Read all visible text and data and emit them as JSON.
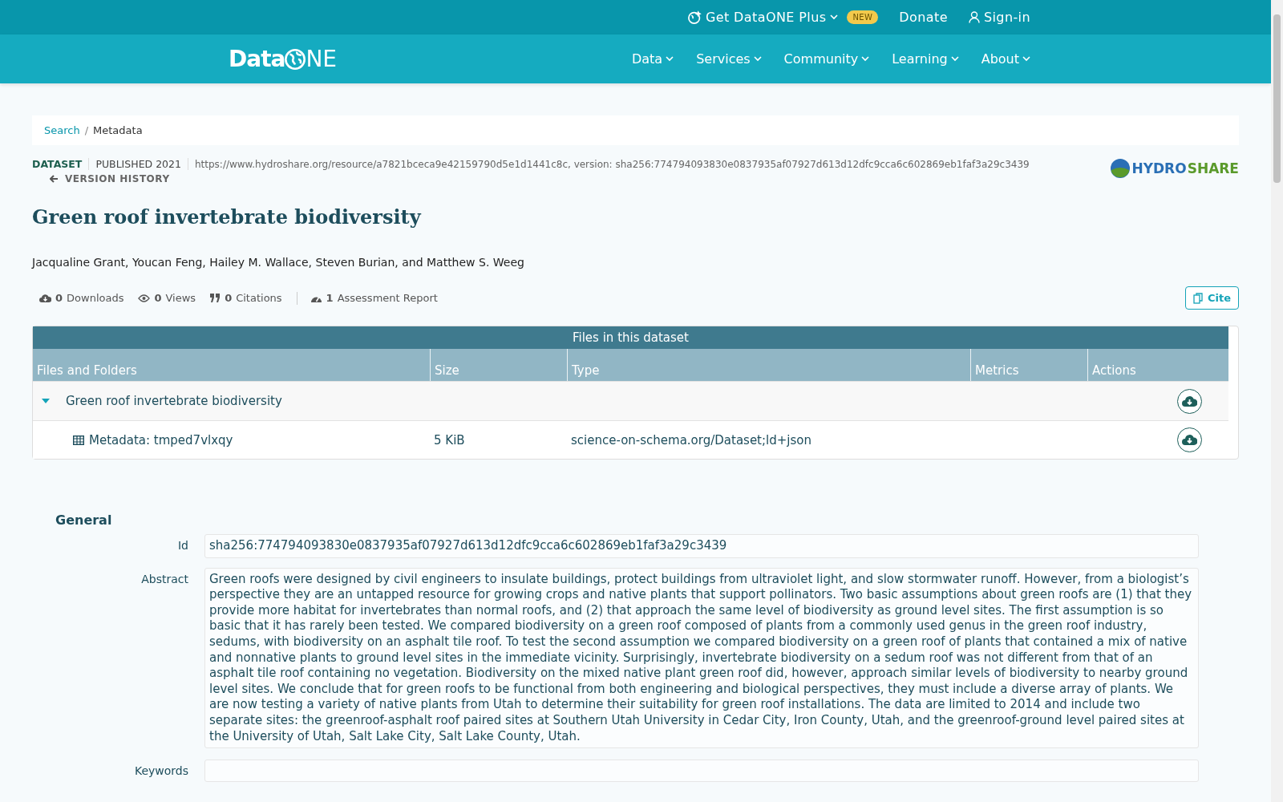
{
  "topbar": {
    "plus": "Get DataONE Plus",
    "badge": "NEW",
    "donate": "Donate",
    "signin": "Sign-in"
  },
  "logo": {
    "before": "Data",
    "after": "NE"
  },
  "nav": [
    "Data",
    "Services",
    "Community",
    "Learning",
    "About"
  ],
  "breadcrumb": {
    "separator": "/",
    "items": [
      {
        "label": "Search",
        "link": true
      },
      {
        "label": "Metadata",
        "link": false
      }
    ]
  },
  "dataset": {
    "type": "DATASET",
    "published": "PUBLISHED 2021",
    "identifier": "https://www.hydroshare.org/resource/a7821bceca9e42159790d5e1d1441c8c, version: sha256:774794093830e0837935af07927d613d12dfc9cca6c602869eb1faf3a29c3439",
    "repo_a": "HYDRO",
    "repo_b": "SHARE",
    "version_history": "VERSION HISTORY"
  },
  "title": "Green roof invertebrate biodiversity",
  "authors": "Jacqualine Grant, Youcan Feng, Hailey M. Wallace, Steven Burian, and Matthew S. Weeg",
  "metrics": [
    {
      "kind": "downloads",
      "count": "0",
      "label": "Downloads"
    },
    {
      "kind": "views",
      "count": "0",
      "label": "Views"
    },
    {
      "kind": "citations",
      "count": "0",
      "label": "Citations"
    },
    {
      "kind": "assessment",
      "count": "1",
      "label": "Assessment Report"
    }
  ],
  "cite": "Cite",
  "files": {
    "caption": "Files in this dataset",
    "columns": [
      "Files and Folders",
      "Size",
      "Type",
      "Metrics",
      "Actions"
    ],
    "folder": {
      "name": "Green roof invertebrate biodiversity",
      "expanded": true
    },
    "rows": [
      {
        "name": "Metadata: tmped7vlxqy",
        "size": "5 KiB",
        "type": "science-on-schema.org/Dataset;ld+json"
      }
    ]
  },
  "general": {
    "heading": "General",
    "fields": [
      {
        "label": "Id",
        "value": "sha256:774794093830e0837935af07927d613d12dfc9cca6c602869eb1faf3a29c3439"
      },
      {
        "label": "Abstract",
        "value": "Green roofs were designed by civil engineers to insulate buildings, protect buildings from ultraviolet light, and slow stormwater runoff. However, from a biologist’s perspective they are an untapped resource for growing crops and native plants that support pollinators. Two basic assumptions about green roofs are (1) that they provide more habitat for invertebrates than normal roofs, and (2) that approach the same level of biodiversity as ground level sites. The first assumption is so basic that it has rarely been tested. We compared biodiversity on a green roof composed of plants from a commonly used genus in the green roof industry, sedums, with biodiversity on an asphalt tile roof. To test the second assumption we compared biodiversity on a green roof of plants that contained a mix of native and nonnative plants to ground level sites in the immediate vicinity. Surprisingly, invertebrate biodiversity on a sedum roof was not different from that of an asphalt tile roof containing no vegetation. Biodiversity on the mixed native plant green roof did, however, approach similar levels of biodiversity to nearby ground level sites. We conclude that for green roofs to be functional from both engineering and biological perspectives, they must include a diverse array of plants. We are now testing a variety of native plants from Utah to determine their suitability for green roof installations. The data are limited to 2014 and include two separate sites: the greenroof-asphalt roof paired sites at Southern Utah University in Cedar City, Iron County, Utah, and the greenroof-ground level paired sites at the University of Utah, Salt Lake City, Salt Lake County, Utah."
      },
      {
        "label": "Keywords"
      }
    ]
  }
}
